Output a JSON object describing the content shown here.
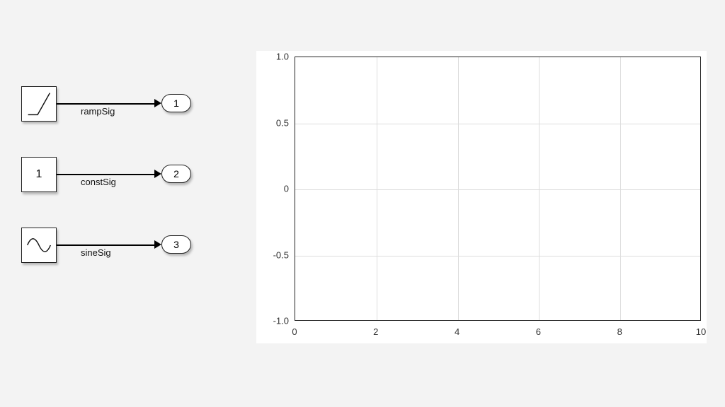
{
  "diagram": {
    "blocks": {
      "ramp": {
        "signal_label": "rampSig",
        "outport_id": "1"
      },
      "const": {
        "value_label": "1",
        "signal_label": "constSig",
        "outport_id": "2"
      },
      "sine": {
        "signal_label": "sineSig",
        "outport_id": "3"
      }
    }
  },
  "chart_data": {
    "type": "line",
    "series": [],
    "x_ticks": [
      "0",
      "2",
      "4",
      "6",
      "8",
      "10"
    ],
    "y_ticks": [
      "-1.0",
      "-0.5",
      "0",
      "0.5",
      "1.0"
    ],
    "xlim": [
      0,
      10
    ],
    "ylim": [
      -1,
      1
    ],
    "title": "",
    "xlabel": "",
    "ylabel": ""
  }
}
